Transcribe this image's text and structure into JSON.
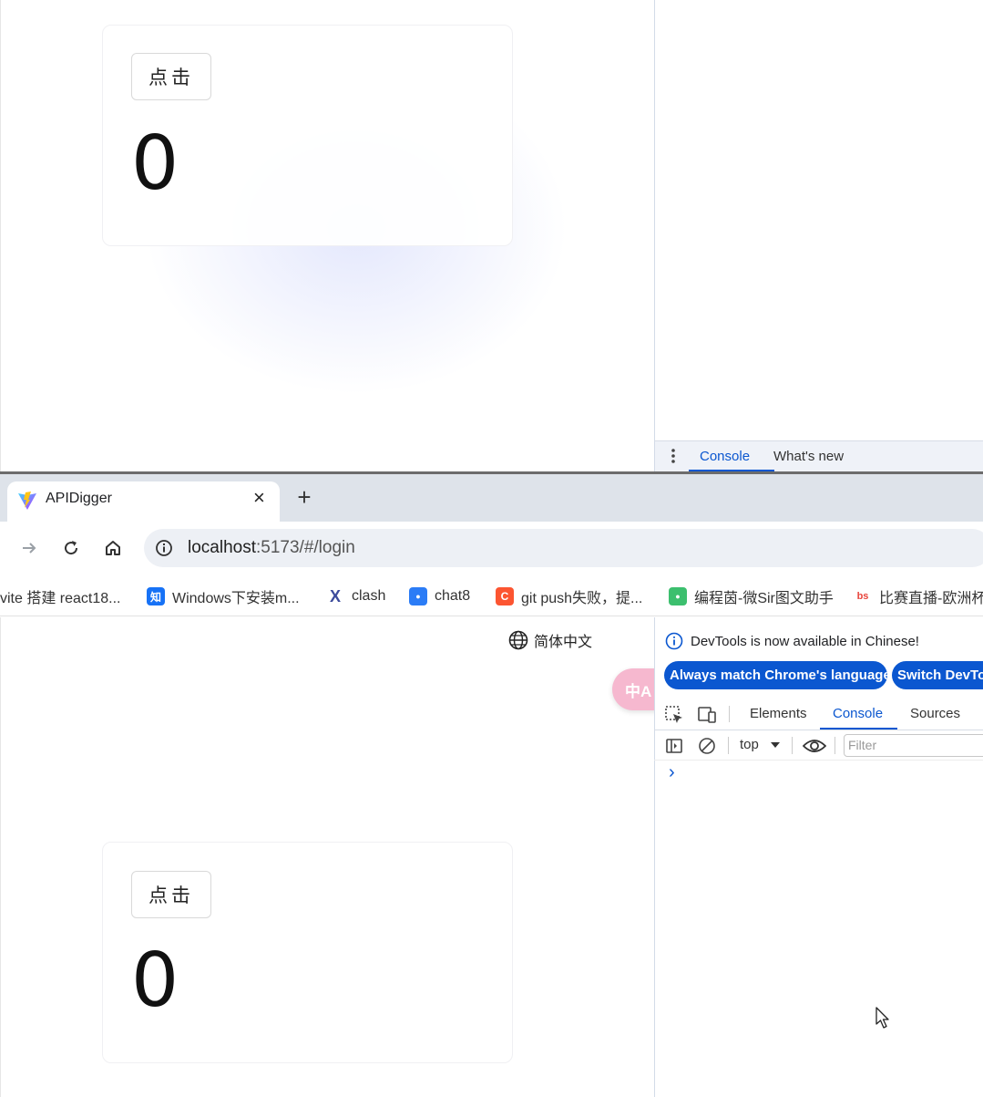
{
  "top_frame": {
    "counter": {
      "button_label": "点击",
      "value": "0"
    },
    "drawer": {
      "tabs": [
        "Console",
        "What's new"
      ],
      "active_tab": "Console"
    }
  },
  "browser": {
    "tab": {
      "title": "APIDigger",
      "close": "×",
      "new_tab": "+"
    },
    "address": {
      "host": "localhost",
      "rest": ":5173/#/login"
    },
    "bookmarks": [
      {
        "label": "vite 搭建 react18...",
        "icon": "none",
        "color": ""
      },
      {
        "label": "Windows下安装m...",
        "icon": "zhihu-icon",
        "color": "#1772f6",
        "glyph": "知"
      },
      {
        "label": "clash",
        "icon": "x-icon",
        "color": "#3c4b9c",
        "glyph": "X"
      },
      {
        "label": "chat8",
        "icon": "chat-icon",
        "color": "#2b7cf6",
        "glyph": "●"
      },
      {
        "label": "git push失败，提...",
        "icon": "csdn-icon",
        "color": "#fc5531",
        "glyph": "C"
      },
      {
        "label": "编程茵-微Sir图文助手",
        "icon": "wechat-icon",
        "color": "#3cbf6e",
        "glyph": "●"
      },
      {
        "label": "比赛直播-欧洲杯",
        "icon": "sports-icon",
        "color": "#e8453c",
        "glyph": "bs"
      }
    ]
  },
  "page": {
    "language_label": "简体中文",
    "translate_glyph": "中A",
    "counter": {
      "button_label": "点击",
      "value": "0"
    }
  },
  "devtools": {
    "info_text": "DevTools is now available in Chinese!",
    "buttons": [
      "Always match Chrome's language",
      "Switch DevTo"
    ],
    "tabs": [
      "Elements",
      "Console",
      "Sources"
    ],
    "active_tab": "Console",
    "context": "top",
    "filter_placeholder": "Filter",
    "prompt": "›"
  },
  "colors": {
    "accent": "#0b57d0",
    "tabstrip": "#dee3ea",
    "omnibox": "#edf0f5"
  }
}
